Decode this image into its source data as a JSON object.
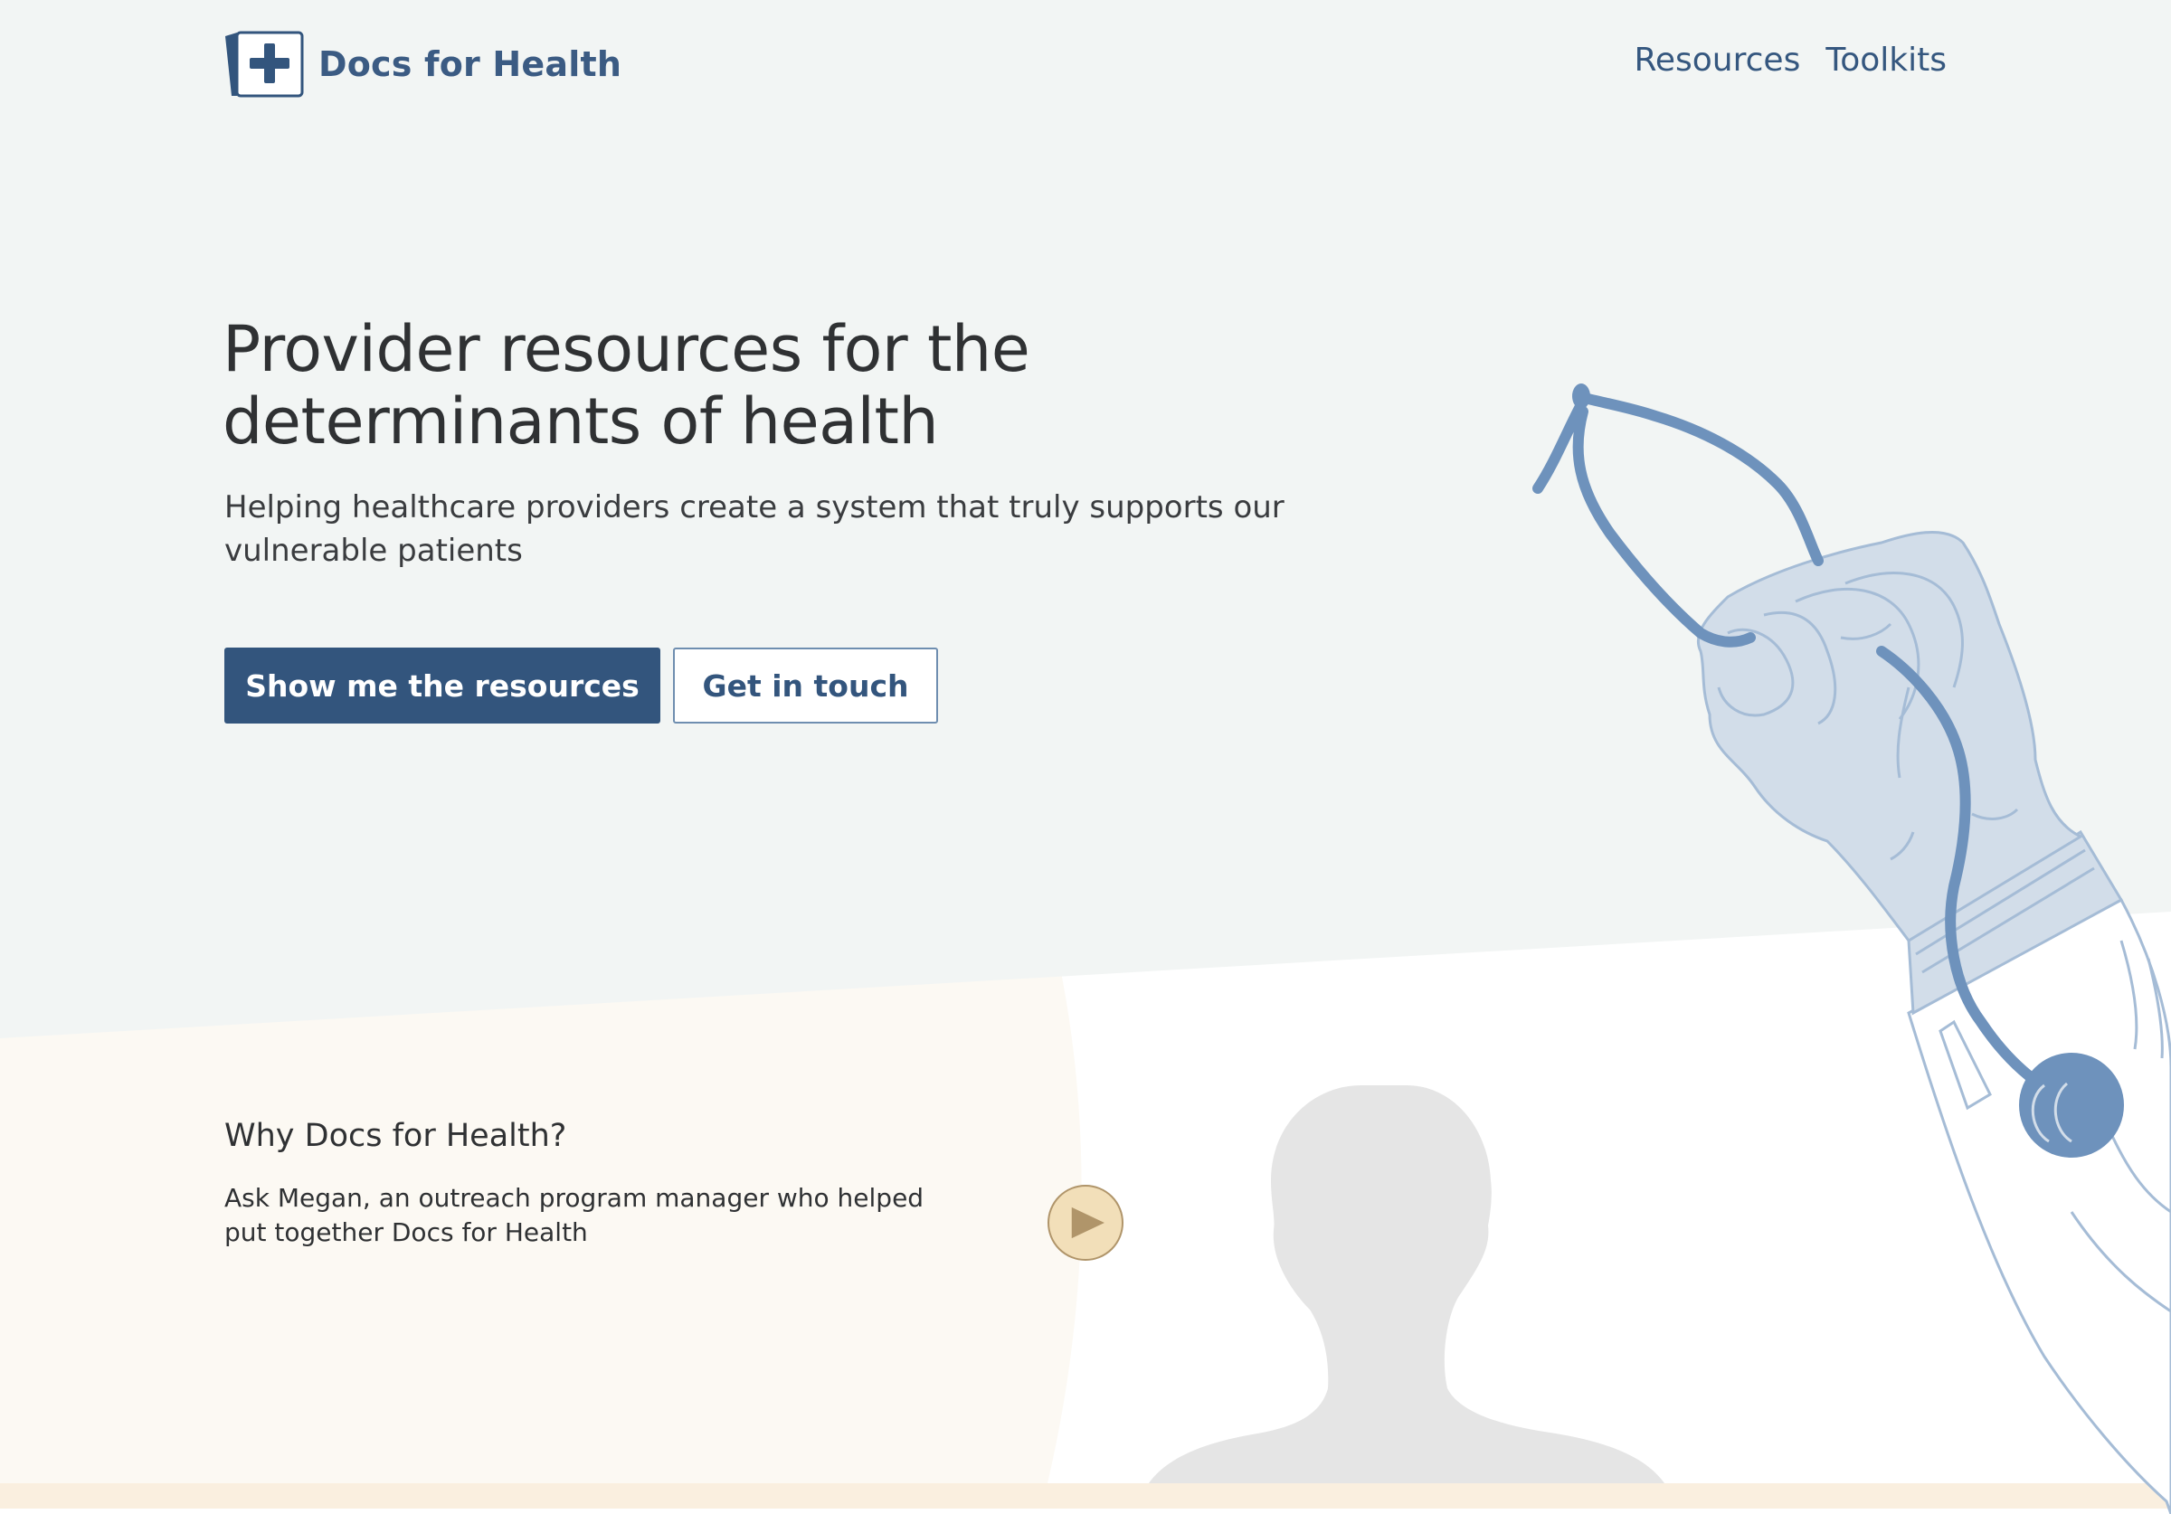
{
  "header": {
    "brand_name": "Docs for Health",
    "nav": [
      {
        "label": "Resources"
      },
      {
        "label": "Toolkits"
      }
    ]
  },
  "hero": {
    "title": "Provider resources for the determinants of health",
    "subtitle": "Helping healthcare providers create a system that truly supports our vulnerable patients",
    "primary_button": "Show me the resources",
    "secondary_button": "Get in touch"
  },
  "why": {
    "heading": "Why Docs for Health?",
    "text": "Ask Megan, an outreach program manager who helped put together Docs for Health"
  },
  "icons": {
    "logo": "medical-plus-icon",
    "play": "play-icon"
  },
  "colors": {
    "hero_background": "#f2f5f4",
    "warm_background": "#fcf9f3",
    "primary": "#33557d",
    "illustration_blue": "#6e92bc",
    "glove_fill": "#d2dde9",
    "play_fill": "#f2dfb9",
    "silhouette": "#e5e5e5",
    "footer_strip": "#faefdf"
  }
}
